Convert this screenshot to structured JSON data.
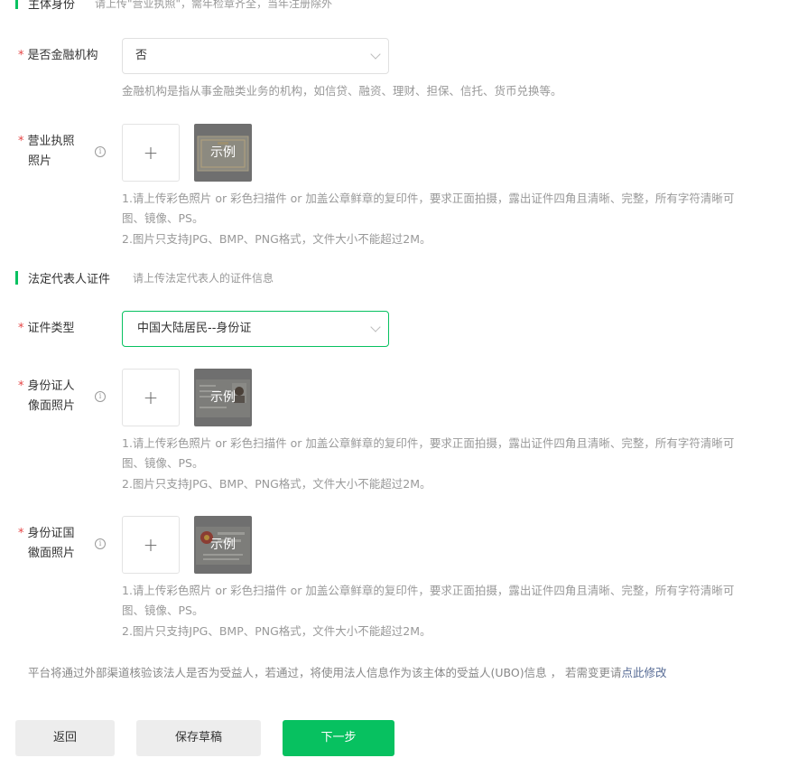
{
  "sections": {
    "subject": {
      "title": "主体身份",
      "subtitle": "请上传\"营业执照\"，需年检章齐全，当年注册除外"
    },
    "legal": {
      "title": "法定代表人证件",
      "subtitle": "请上传法定代表人的证件信息"
    }
  },
  "fields": {
    "financial": {
      "label": "是否金融机构",
      "value": "否",
      "hint": "金融机构是指从事金融类业务的机构，如信贷、融资、理财、担保、信托、货币兑换等。"
    },
    "license": {
      "label_line1": "营业执照",
      "label_line2": "照片"
    },
    "id_type": {
      "label": "证件类型",
      "value": "中国大陆居民--身份证"
    },
    "id_front": {
      "label_line1": "身份证人",
      "label_line2": "像面照片"
    },
    "id_back": {
      "label_line1": "身份证国",
      "label_line2": "徽面照片"
    }
  },
  "upload": {
    "plus": "+",
    "sample": "示例",
    "info_glyph": "i"
  },
  "upload_hint": {
    "line1": "1.请上传彩色照片 or 彩色扫描件 or 加盖公章鲜章的复印件，要求正面拍摄，露出证件四角且清晰、完整，所有字符清晰可",
    "line2": "图、镜像、PS。",
    "line3": "2.图片只支持JPG、BMP、PNG格式，文件大小不能超过2M。"
  },
  "notice": {
    "text": "平台将通过外部渠道核验该法人是否为受益人，若通过，将使用法人信息作为该主体的受益人(UBO)信息 ，  若需变更请",
    "link": "点此修改"
  },
  "buttons": {
    "back": "返回",
    "save_draft": "保存草稿",
    "next": "下一步"
  },
  "required_mark": "*",
  "colors": {
    "accent": "#07c160",
    "required": "#e54545",
    "link": "#576b95",
    "hint": "#999999"
  }
}
